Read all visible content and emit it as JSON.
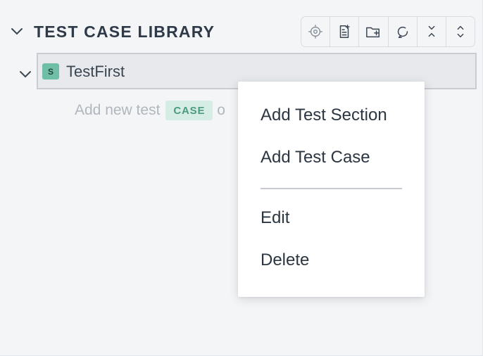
{
  "library": {
    "title": "TEST CASE LIBRARY",
    "toolbar": [
      {
        "icon": "locate-icon"
      },
      {
        "icon": "add-file-icon"
      },
      {
        "icon": "add-folder-icon"
      },
      {
        "icon": "refresh-icon"
      },
      {
        "icon": "collapse-all-icon"
      },
      {
        "icon": "expand-all-icon"
      }
    ]
  },
  "tree": {
    "node": {
      "badge": "S",
      "label": "TestFirst"
    },
    "add_row": {
      "text": "Add new test",
      "tag": "CASE",
      "suffix": "o"
    }
  },
  "context_menu": {
    "items": [
      "Add Test Section",
      "Add Test Case",
      "Edit",
      "Delete"
    ]
  },
  "colors": {
    "background": "#f4f5f7",
    "badge": "#6fbfa7",
    "case_tag_bg": "#d5ede4",
    "case_tag_text": "#4c9b80",
    "selected_row": "#e7e9ec"
  }
}
